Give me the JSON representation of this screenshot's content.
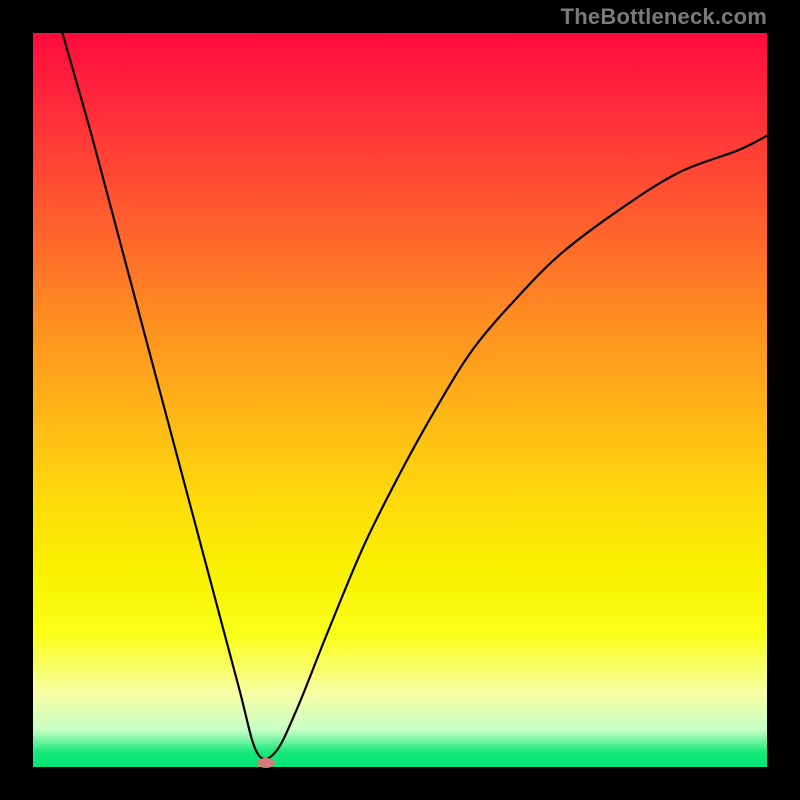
{
  "watermark": "TheBottleneck.com",
  "colors": {
    "background": "#000000",
    "curve": "#000000",
    "vertex_dot": "#d37c7c"
  },
  "layout": {
    "outer_size": 800,
    "plot_inset": 33,
    "plot_size": 734
  },
  "chart_data": {
    "type": "line",
    "title": "",
    "xlabel": "",
    "ylabel": "",
    "x_range": [
      0,
      1
    ],
    "y_range": [
      0,
      1
    ],
    "grid": false,
    "legend": false,
    "series": [
      {
        "name": "bottleneck-curve",
        "x": [
          0.04,
          0.08,
          0.12,
          0.16,
          0.2,
          0.24,
          0.28,
          0.305,
          0.33,
          0.36,
          0.4,
          0.45,
          0.5,
          0.55,
          0.6,
          0.66,
          0.72,
          0.8,
          0.88,
          0.96,
          1.0
        ],
        "y": [
          1.0,
          0.86,
          0.71,
          0.56,
          0.41,
          0.26,
          0.11,
          0.02,
          0.02,
          0.08,
          0.18,
          0.3,
          0.4,
          0.49,
          0.57,
          0.64,
          0.7,
          0.76,
          0.81,
          0.84,
          0.86
        ]
      }
    ],
    "vertex": {
      "x": 0.317,
      "y": 0.005
    }
  }
}
